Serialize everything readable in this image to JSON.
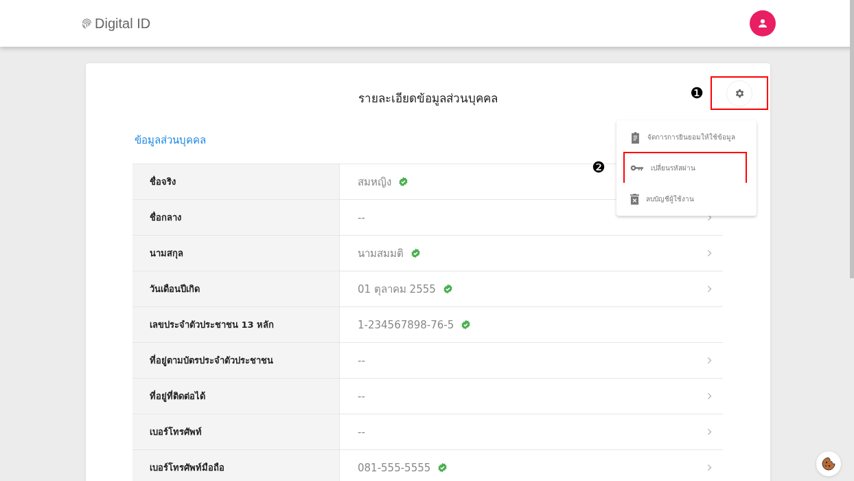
{
  "header": {
    "brand": "Digital ID"
  },
  "card": {
    "title": "รายละเอียดข้อมูลส่วนบุคคล",
    "section_title": "ข้อมูลส่วนบุคคล"
  },
  "annotations": [
    "❶",
    "❷"
  ],
  "settings_menu": {
    "open": true,
    "items": [
      {
        "kind": "consent",
        "label": "จัดการการยินยอมให้ใช้ข้อมูล",
        "highlighted": false
      },
      {
        "kind": "password",
        "label": "เปลี่ยนรหัสผ่าน",
        "highlighted": true
      },
      {
        "kind": "delete",
        "label": "ลบบัญชีผู้ใช้งาน",
        "highlighted": false
      }
    ]
  },
  "rows": [
    {
      "label": "ชื่อจริง",
      "value": "สมหญิง",
      "verified": true,
      "arrow": false
    },
    {
      "label": "ชื่อกลาง",
      "value": "--",
      "verified": false,
      "arrow": true
    },
    {
      "label": "นามสกุล",
      "value": "นามสมมติ",
      "verified": true,
      "arrow": true
    },
    {
      "label": "วันเดือนปีเกิด",
      "value": "01 ตุลาคม 2555",
      "verified": true,
      "arrow": true
    },
    {
      "label": "เลขประจำตัวประชาชน 13 หลัก",
      "value": "1-234567898-76-5",
      "verified": true,
      "arrow": false
    },
    {
      "label": "ที่อยู่ตามบัตรประจำตัวประชาชน",
      "value": "--",
      "verified": false,
      "arrow": true
    },
    {
      "label": "ที่อยู่ที่ติดต่อได้",
      "value": "--",
      "verified": false,
      "arrow": true
    },
    {
      "label": "เบอร์โทรศัพท์",
      "value": "--",
      "verified": false,
      "arrow": true
    },
    {
      "label": "เบอร์โทรศัพท์มือถือ",
      "value": "081-555-5555",
      "verified": true,
      "arrow": true
    }
  ]
}
